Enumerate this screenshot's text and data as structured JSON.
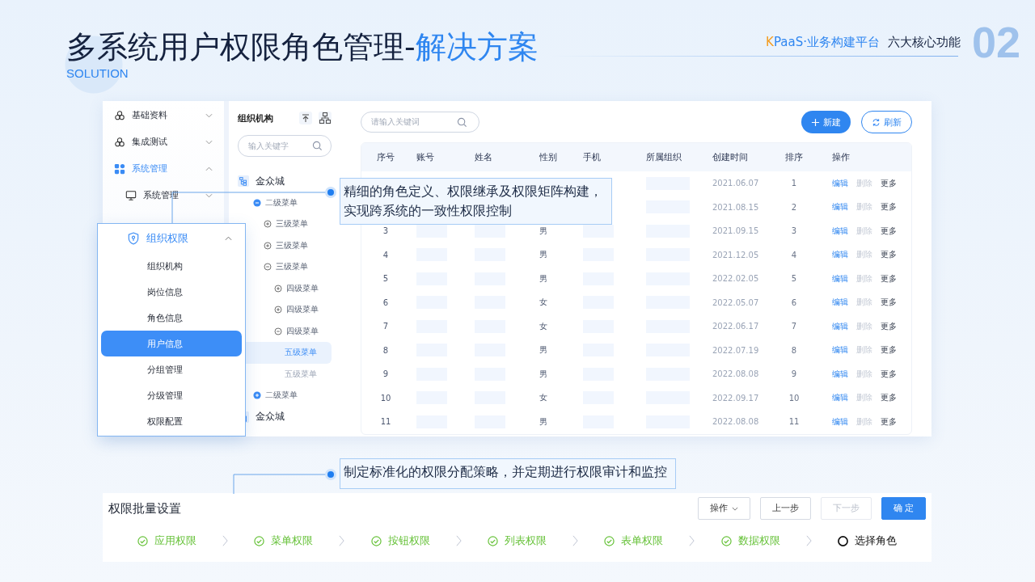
{
  "header": {
    "title": "多系统用户权限角色管理-",
    "title_highlight": "解决方案",
    "subtitle": "SOLUTION",
    "brand_mark": "K",
    "brand": "PaaS·业务构建平台",
    "section": "六大核心功能",
    "number": "02"
  },
  "nav": {
    "items": [
      {
        "label": "基础资料",
        "expanded": false,
        "active": false
      },
      {
        "label": "集成测试",
        "expanded": false,
        "active": false
      },
      {
        "label": "系统管理",
        "expanded": true,
        "active": true,
        "children": [
          {
            "label": "系统管理",
            "expanded": false
          }
        ]
      }
    ]
  },
  "menu": {
    "title": "组织权限",
    "expanded": true,
    "items": [
      {
        "label": "组织机构",
        "selected": false
      },
      {
        "label": "岗位信息",
        "selected": false
      },
      {
        "label": "角色信息",
        "selected": false
      },
      {
        "label": "用户信息",
        "selected": true
      },
      {
        "label": "分组管理",
        "selected": false
      },
      {
        "label": "分级管理",
        "selected": false
      },
      {
        "label": "权限配置",
        "selected": false
      }
    ]
  },
  "tree": {
    "title": "组织机构",
    "search": {
      "placeholder": "输入关键字"
    },
    "nodes": [
      {
        "label": "金众城",
        "kind": "root",
        "children": [
          {
            "label": "二级菜单",
            "expanded": true,
            "children": [
              {
                "label": "三级菜单",
                "expanded": false
              },
              {
                "label": "三级菜单",
                "expanded": false
              },
              {
                "label": "三级菜单",
                "expanded": true,
                "children": [
                  {
                    "label": "四级菜单",
                    "expanded": false
                  },
                  {
                    "label": "四级菜单",
                    "expanded": false
                  },
                  {
                    "label": "四级菜单",
                    "expanded": true,
                    "children": [
                      {
                        "label": "五级菜单",
                        "selected": true
                      },
                      {
                        "label": "五级菜单",
                        "selected": false
                      }
                    ]
                  }
                ]
              }
            ]
          },
          {
            "label": "二级菜单",
            "expanded": false
          }
        ]
      },
      {
        "label": "金众城",
        "kind": "root"
      }
    ]
  },
  "table": {
    "search": {
      "placeholder": "请输入关键词"
    },
    "buttons": [
      {
        "label": "新建",
        "kind": "primary"
      },
      {
        "label": "刷新",
        "kind": "outline"
      }
    ],
    "columns": [
      "序号",
      "账号",
      "姓名",
      "性别",
      "手机",
      "所属组织",
      "创建时间",
      "排序",
      "操作"
    ],
    "rows": [
      {
        "created": "2021.06.07",
        "order": "1",
        "actions": [
          {
            "label": "编辑",
            "kind": "link",
            "disabled": false
          },
          {
            "label": "删除",
            "kind": "plain",
            "disabled": true
          },
          {
            "label": "更多",
            "kind": "plain",
            "disabled": false
          }
        ]
      },
      {
        "created": "2021.08.15",
        "order": "2",
        "actions": [
          {
            "label": "编辑",
            "kind": "link",
            "disabled": false
          },
          {
            "label": "删除",
            "kind": "plain",
            "disabled": true
          },
          {
            "label": "更多",
            "kind": "plain",
            "disabled": false
          }
        ]
      },
      {
        "seq": "3",
        "gender": "男",
        "created": "2021.09.15",
        "order": "3",
        "actions": [
          {
            "label": "编辑",
            "kind": "link",
            "disabled": false
          },
          {
            "label": "删除",
            "kind": "plain",
            "disabled": true
          },
          {
            "label": "更多",
            "kind": "plain",
            "disabled": false
          }
        ]
      },
      {
        "seq": "4",
        "gender": "男",
        "created": "2021.12.05",
        "order": "4",
        "actions": [
          {
            "label": "编辑",
            "kind": "link",
            "disabled": false
          },
          {
            "label": "删除",
            "kind": "plain",
            "disabled": true
          },
          {
            "label": "更多",
            "kind": "plain",
            "disabled": false
          }
        ]
      },
      {
        "seq": "5",
        "gender": "男",
        "created": "2022.02.05",
        "order": "5",
        "actions": [
          {
            "label": "编辑",
            "kind": "link",
            "disabled": false
          },
          {
            "label": "删除",
            "kind": "plain",
            "disabled": true
          },
          {
            "label": "更多",
            "kind": "plain",
            "disabled": false
          }
        ]
      },
      {
        "seq": "6",
        "gender": "女",
        "created": "2022.05.07",
        "order": "6",
        "actions": [
          {
            "label": "编辑",
            "kind": "link",
            "disabled": false
          },
          {
            "label": "删除",
            "kind": "plain",
            "disabled": true
          },
          {
            "label": "更多",
            "kind": "plain",
            "disabled": false
          }
        ]
      },
      {
        "seq": "7",
        "gender": "女",
        "created": "2022.06.17",
        "order": "7",
        "actions": [
          {
            "label": "编辑",
            "kind": "link",
            "disabled": false
          },
          {
            "label": "删除",
            "kind": "plain",
            "disabled": true
          },
          {
            "label": "更多",
            "kind": "plain",
            "disabled": false
          }
        ]
      },
      {
        "seq": "8",
        "gender": "男",
        "created": "2022.07.19",
        "order": "8",
        "actions": [
          {
            "label": "编辑",
            "kind": "link",
            "disabled": false
          },
          {
            "label": "删除",
            "kind": "plain",
            "disabled": true
          },
          {
            "label": "更多",
            "kind": "plain",
            "disabled": false
          }
        ]
      },
      {
        "seq": "9",
        "gender": "男",
        "created": "2022.08.08",
        "order": "9",
        "actions": [
          {
            "label": "编辑",
            "kind": "link",
            "disabled": false
          },
          {
            "label": "删除",
            "kind": "plain",
            "disabled": true
          },
          {
            "label": "更多",
            "kind": "plain",
            "disabled": false
          }
        ]
      },
      {
        "seq": "10",
        "gender": "女",
        "created": "2022.09.17",
        "order": "10",
        "actions": [
          {
            "label": "编辑",
            "kind": "link",
            "disabled": false
          },
          {
            "label": "删除",
            "kind": "plain",
            "disabled": true
          },
          {
            "label": "更多",
            "kind": "plain",
            "disabled": false
          }
        ]
      },
      {
        "seq": "11",
        "gender": "男",
        "created": "2022.08.08",
        "order": "11",
        "actions": [
          {
            "label": "编辑",
            "kind": "link",
            "disabled": false
          },
          {
            "label": "删除",
            "kind": "plain",
            "disabled": true
          },
          {
            "label": "更多",
            "kind": "plain",
            "disabled": false
          }
        ]
      }
    ]
  },
  "callouts": [
    {
      "text": "精细的角色定义、权限继承及权限矩阵构建，实现跨系统的一致性权限控制"
    },
    {
      "text": "制定标准化的权限分配策略，并定期进行权限审计和监控"
    }
  ],
  "batch": {
    "title": "权限批量设置",
    "buttons": [
      {
        "label": "操作",
        "kind": "dropdown",
        "disabled": false
      },
      {
        "label": "上一步",
        "kind": "default",
        "disabled": false
      },
      {
        "label": "下一步",
        "kind": "default",
        "disabled": true
      },
      {
        "label": "确 定",
        "kind": "primary",
        "disabled": false
      }
    ],
    "steps": [
      {
        "label": "应用权限",
        "done": true
      },
      {
        "label": "菜单权限",
        "done": true
      },
      {
        "label": "按钮权限",
        "done": true
      },
      {
        "label": "列表权限",
        "done": true
      },
      {
        "label": "表单权限",
        "done": true
      },
      {
        "label": "数据权限",
        "done": true
      },
      {
        "label": "选择角色",
        "done": false
      }
    ]
  }
}
